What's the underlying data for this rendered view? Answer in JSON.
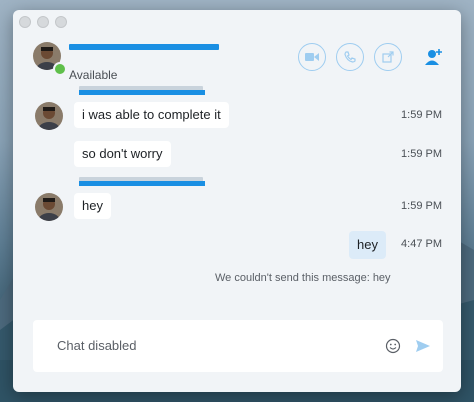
{
  "window": {
    "contact_status": "Available"
  },
  "header": {
    "video_call_icon": "video-icon",
    "audio_call_icon": "phone-icon",
    "share_icon": "share-icon",
    "add_people_icon": "add-person-icon"
  },
  "messages": [
    {
      "text": "i was able to complete it",
      "time": "1:59 PM",
      "direction": "in"
    },
    {
      "text": "so don't worry",
      "time": "1:59 PM",
      "direction": "in"
    },
    {
      "text": "hey",
      "time": "1:59 PM",
      "direction": "in"
    },
    {
      "text": "hey",
      "time": "4:47 PM",
      "direction": "out"
    }
  ],
  "error_notice": "We couldn't send this message: hey",
  "composer": {
    "placeholder": "Chat disabled",
    "emoji_icon": "emoji-icon",
    "send_icon": "send-icon"
  },
  "colors": {
    "accent": "#1a8fe3",
    "available": "#5fbf4a",
    "outgoing_bubble": "#dcebf8"
  }
}
